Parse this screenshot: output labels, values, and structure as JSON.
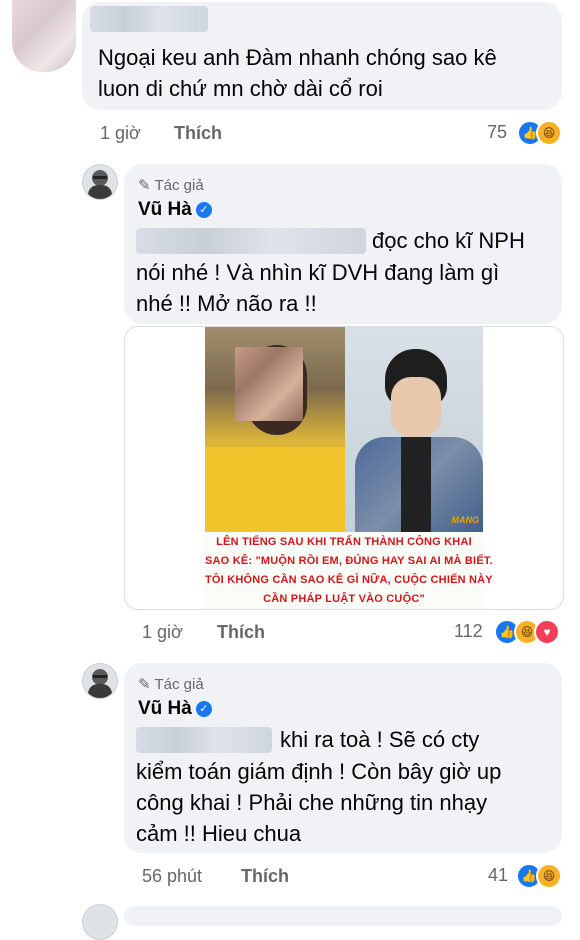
{
  "comments": [
    {
      "text": "Ngoại keu anh Đàm nhanh chóng sao kê luon di chứ mn chờ dài cổ roi",
      "line1": "Ngoại keu anh Đàm nhanh chóng sao kê",
      "line2": "luon di chứ mn chờ dài cổ roi",
      "time": "1 giờ",
      "like_label": "Thích",
      "reaction_count": "75"
    },
    {
      "author_tag": "Tác giả",
      "author": "Vũ Hà",
      "line1_suffix": "đọc cho kĩ NPH",
      "line2": "nói nhé ! Và nhìn kĩ DVH đang làm gì",
      "line3": "nhé !! Mở não ra !!",
      "image_caption": [
        "LÊN TIẾNG SAU KHI TRẤN THÀNH CÔNG KHAI",
        "SAO KÊ: \"MUỘN RỒI EM, ĐÚNG HAY SAI AI MÀ BIẾT.",
        "TÔI KHÔNG CẦN SAO KÊ GÌ NỮA, CUỘC CHIẾN NÀY",
        "CẦN PHÁP LUẬT VÀO CUỘC\""
      ],
      "image_watermark": "MANG",
      "time": "1 giờ",
      "like_label": "Thích",
      "reaction_count": "112"
    },
    {
      "author_tag": "Tác giả",
      "author": "Vũ Hà",
      "line1_suffix": "khi ra toà ! Sẽ có cty",
      "line2": "kiểm toán giám định ! Còn bây giờ up",
      "line3": "công khai ! Phải che những tin nhạy",
      "line4": "cảm !! Hieu chua",
      "time": "56 phút",
      "like_label": "Thích",
      "reaction_count": "41"
    }
  ],
  "colors": {
    "like": "#1877f2",
    "haha": "#f7b125",
    "love": "#f33e58",
    "bubble": "#f0f2f5",
    "meta": "#65676b"
  },
  "icons": [
    "pencil-icon",
    "verified-badge-icon",
    "like-reaction-icon",
    "haha-reaction-icon",
    "love-reaction-icon"
  ]
}
